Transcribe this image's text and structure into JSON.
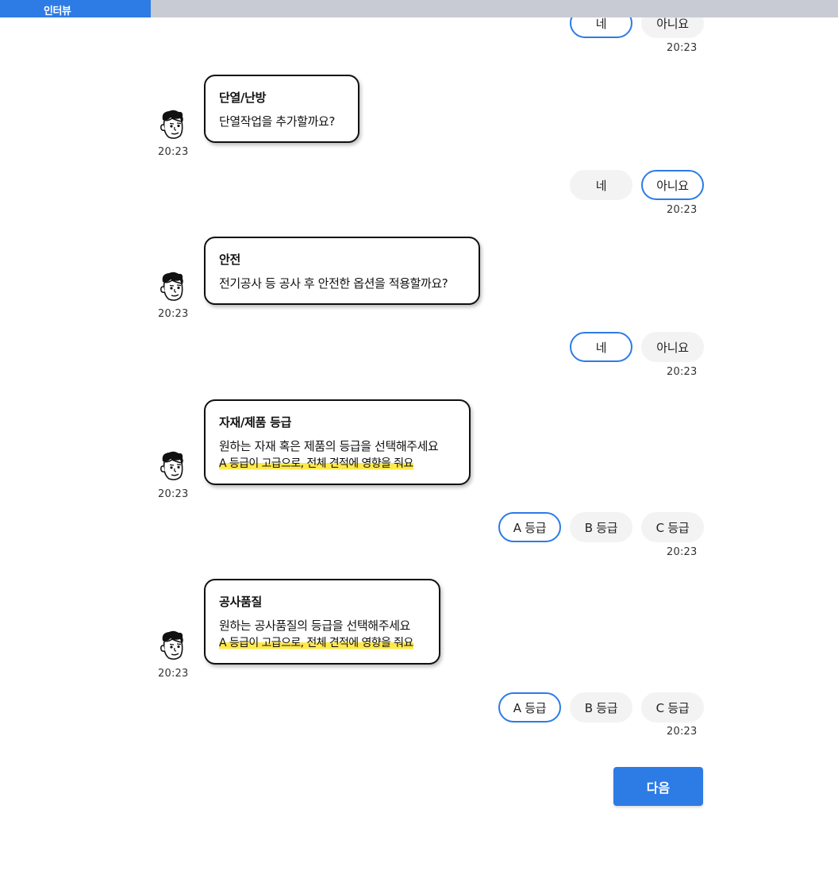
{
  "header": {
    "tab_label": "인터뷰",
    "progress": 0.18,
    "accent_color": "#2d7be5",
    "track_color": "#c8cbd4"
  },
  "messages": [
    {
      "type": "reply",
      "options": [
        "네",
        "아니요"
      ],
      "selected": 0,
      "time": "20:23"
    },
    {
      "type": "bot",
      "avatar_icon": "cartoon-face-icon",
      "title": "단열/난방",
      "text": "단열작업을 추가할까요?",
      "time": "20:23"
    },
    {
      "type": "reply",
      "options": [
        "네",
        "아니요"
      ],
      "selected": 1,
      "time": "20:23"
    },
    {
      "type": "bot",
      "avatar_icon": "cartoon-face-icon",
      "title": "안전",
      "text": "전기공사 등 공사 후 안전한 옵션을 적용할까요?",
      "time": "20:23"
    },
    {
      "type": "reply",
      "options": [
        "네",
        "아니요"
      ],
      "selected": 0,
      "time": "20:23"
    },
    {
      "type": "bot",
      "avatar_icon": "cartoon-face-icon",
      "title": "자재/제품 등급",
      "text": "원하는 자재 혹은 제품의 등급을 선택해주세요",
      "note": "A 등급이 고급으로, 전체 견적에 영향을 줘요",
      "time": "20:23"
    },
    {
      "type": "reply",
      "options": [
        "A 등급",
        "B 등급",
        "C 등급"
      ],
      "selected": 0,
      "time": "20:23"
    },
    {
      "type": "bot",
      "avatar_icon": "cartoon-face-icon",
      "title": "공사품질",
      "text": "원하는 공사품질의 등급을 선택해주세요",
      "note": "A 등급이 고급으로, 전체 견적에 영향을 줘요",
      "time": "20:23"
    },
    {
      "type": "reply",
      "options": [
        "A 등급",
        "B 등급",
        "C 등급"
      ],
      "selected": 0,
      "time": "20:23"
    }
  ],
  "next_button": {
    "label": "다음"
  }
}
